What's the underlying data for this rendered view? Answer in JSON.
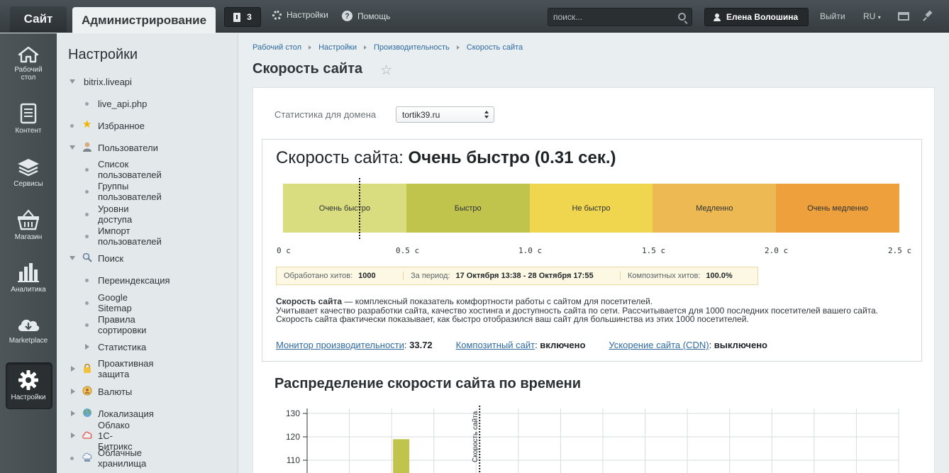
{
  "topbar": {
    "site_tab": "Сайт",
    "admin_tab": "Администрирование",
    "notifications_count": "3",
    "settings_link": "Настройки",
    "help_link": "Помощь",
    "search_placeholder": "поиск...",
    "user_name": "Елена Волошина",
    "logout": "Выйти",
    "language": "RU"
  },
  "iconbar": [
    {
      "label": "Рабочий стол",
      "icon": "home-icon"
    },
    {
      "label": "Контент",
      "icon": "document-icon"
    },
    {
      "label": "Сервисы",
      "icon": "layers-icon"
    },
    {
      "label": "Магазин",
      "icon": "basket-icon"
    },
    {
      "label": "Аналитика",
      "icon": "chart-icon"
    },
    {
      "label": "Marketplace",
      "icon": "cloud-download-icon"
    },
    {
      "label": "Настройки",
      "icon": "gear-icon",
      "active": true
    }
  ],
  "sidemenu": {
    "title": "Настройки",
    "items": [
      {
        "label": "bitrix.liveapi",
        "level": 0,
        "toggle": "expanded"
      },
      {
        "label": "live_api.php",
        "level": 1
      },
      {
        "label": "Избранное",
        "level": 0,
        "icon": "star-icon"
      },
      {
        "label": "Пользователи",
        "level": 0,
        "toggle": "expanded",
        "icon": "user-icon"
      },
      {
        "label": "Список пользователей",
        "level": 1
      },
      {
        "label": "Группы пользователей",
        "level": 1
      },
      {
        "label": "Уровни доступа",
        "level": 1
      },
      {
        "label": "Импорт пользователей",
        "level": 1
      },
      {
        "label": "Поиск",
        "level": 0,
        "toggle": "expanded",
        "icon": "search-icon"
      },
      {
        "label": "Переиндексация",
        "level": 1
      },
      {
        "label": "Google Sitemap",
        "level": 1
      },
      {
        "label": "Правила сортировки",
        "level": 1
      },
      {
        "label": "Статистика",
        "level": 1,
        "toggle": "collapsed"
      },
      {
        "label": "Проактивная защита",
        "level": 0,
        "toggle": "collapsed",
        "icon": "lock-icon"
      },
      {
        "label": "Валюты",
        "level": 0,
        "toggle": "collapsed",
        "icon": "coin-icon"
      },
      {
        "label": "Локализация",
        "level": 0,
        "toggle": "collapsed",
        "icon": "globe-icon"
      },
      {
        "label": "Облако 1С-Битрикс",
        "level": 0,
        "toggle": "collapsed",
        "icon": "cloud-icon"
      },
      {
        "label": "Облачные хранилища",
        "level": 0,
        "icon": "storage-icon"
      }
    ]
  },
  "breadcrumbs": [
    "Рабочий стол",
    "Настройки",
    "Производительность",
    "Скорость сайта"
  ],
  "page_title": "Скорость сайта",
  "domain_filter": {
    "label": "Статистика для домена",
    "value": "tortik39.ru"
  },
  "speed": {
    "heading_prefix": "Скорость сайта:",
    "heading_value": "Очень быстро (0.31 сек.)",
    "marker_value_sec": 0.31,
    "bands": [
      {
        "label": "Очень быстро",
        "color": "#d9dc7f"
      },
      {
        "label": "Быстро",
        "color": "#c0c44d"
      },
      {
        "label": "Не быстро",
        "color": "#f0d64e"
      },
      {
        "label": "Медленно",
        "color": "#ecb952"
      },
      {
        "label": "Очень медленно",
        "color": "#eda03b"
      }
    ],
    "scale": [
      "0 с",
      "0.5 с",
      "1.0 с",
      "1.5 с",
      "2.0 с",
      "2.5 с"
    ],
    "stats": [
      {
        "label": "Обработано хитов:",
        "value": "1000"
      },
      {
        "label": "За период:",
        "value": "17 Октября 13:38 - 28 Октября 17:55"
      },
      {
        "label": "Композитных хитов:",
        "value": "100.0%"
      }
    ],
    "desc_term": "Скорость сайта",
    "desc_line1": " — комплексный показатель комфортности работы с сайтом для посетителей.",
    "desc_line2": "Учитывает качество разработки сайта, качество хостинга и доступность сайта по сети. Рассчитывается для 1000 последних посетителей вашего сайта.",
    "desc_line3": "Скорость сайта фактически показывает, как быстро отобразился ваш сайт для большинства из этих 1000 посетителей.",
    "links": [
      {
        "label": "Монитор производительности",
        "value": "33.72"
      },
      {
        "label": "Композитный сайт",
        "value": "включено"
      },
      {
        "label": "Ускорение сайта (CDN)",
        "value": "выключено"
      }
    ]
  },
  "distribution_title": "Распределение скорости сайта по времени",
  "chart_data": {
    "type": "bar",
    "y_ticks": [
      130,
      120,
      110
    ],
    "ylim": [
      105,
      130
    ],
    "bars": [
      {
        "x_index": 2,
        "value": 119,
        "color": "#c0c44d"
      }
    ],
    "marker_label": "Скорость сайта",
    "marker_x_index": 4.2,
    "x_divisions": 14
  }
}
